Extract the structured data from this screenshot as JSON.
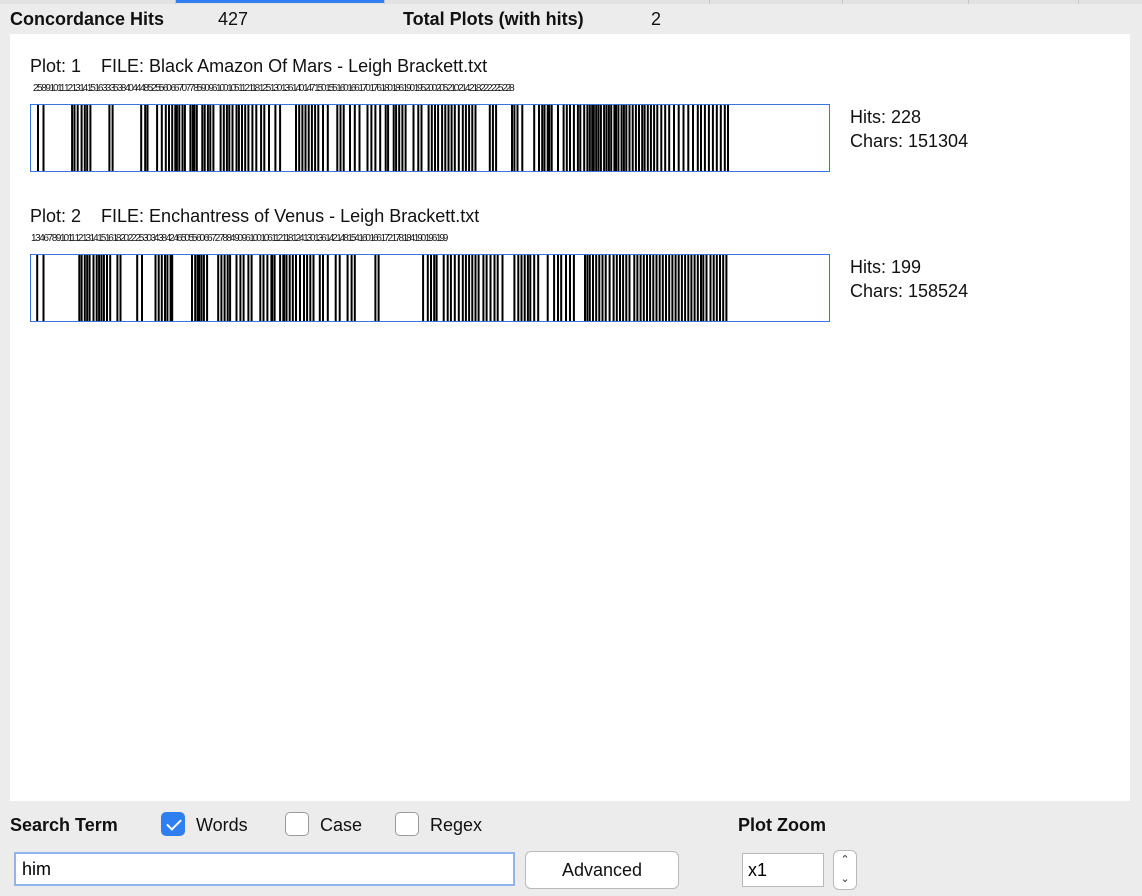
{
  "stats": {
    "concordance_hits_label": "Concordance Hits",
    "concordance_hits_value": "427",
    "total_plots_label": "Total Plots (with hits)",
    "total_plots_value": "2"
  },
  "plots": [
    {
      "title": "Plot: 1    FILE: Black Amazon Of Mars - Leigh Brackett.txt",
      "hits_text": "Hits: 228",
      "chars_text": "Chars: 151304",
      "hits": 228,
      "chars": 151304,
      "hit_positions": [
        0.005,
        0.012,
        0.048,
        0.051,
        0.055,
        0.06,
        0.064,
        0.067,
        0.071,
        0.095,
        0.099,
        0.135,
        0.14,
        0.143,
        0.155,
        0.161,
        0.166,
        0.17,
        0.174,
        0.178,
        0.18,
        0.183,
        0.187,
        0.19,
        0.197,
        0.2,
        0.202,
        0.205,
        0.212,
        0.215,
        0.219,
        0.222,
        0.226,
        0.235,
        0.239,
        0.243,
        0.246,
        0.25,
        0.255,
        0.258,
        0.262,
        0.266,
        0.27,
        0.275,
        0.28,
        0.286,
        0.29,
        0.296,
        0.304,
        0.31,
        0.33,
        0.334,
        0.338,
        0.342,
        0.346,
        0.35,
        0.354,
        0.358,
        0.364,
        0.37,
        0.382,
        0.386,
        0.39,
        0.398,
        0.404,
        0.41,
        0.42,
        0.425,
        0.43,
        0.436,
        0.443,
        0.446,
        0.453,
        0.456,
        0.46,
        0.464,
        0.468,
        0.478,
        0.484,
        0.488,
        0.497,
        0.501,
        0.505,
        0.509,
        0.514,
        0.518,
        0.522,
        0.526,
        0.53,
        0.535,
        0.54,
        0.544,
        0.548,
        0.552,
        0.556,
        0.574,
        0.578,
        0.582,
        0.602,
        0.605,
        0.609,
        0.615,
        0.63,
        0.636,
        0.64,
        0.643,
        0.647,
        0.649,
        0.652,
        0.66,
        0.667,
        0.671,
        0.675,
        0.68,
        0.685,
        0.688,
        0.693,
        0.697,
        0.7,
        0.703,
        0.705,
        0.708,
        0.711,
        0.714,
        0.718,
        0.721,
        0.724,
        0.727,
        0.731,
        0.733,
        0.736,
        0.74,
        0.743,
        0.746,
        0.75,
        0.754,
        0.758,
        0.762,
        0.766,
        0.769,
        0.773,
        0.777,
        0.781,
        0.785,
        0.79,
        0.795,
        0.8,
        0.806,
        0.812,
        0.818,
        0.824,
        0.83,
        0.836,
        0.84,
        0.845,
        0.85,
        0.855,
        0.86,
        0.865,
        0.87,
        0.874
      ],
      "tick_labels": "2 5   8 9 10 11 12 13 14 15 16   33 35 38 40 44 48 52 55 60 66 70 77 85 90 96 100 105 112 118 125 130 136 140 147 150 155 160 166 170 176 180 186 190 195 200 205 210 214 218 222 225 228"
    },
    {
      "title": "Plot: 2    FILE: Enchantress of Venus - Leigh Brackett.txt",
      "hits_text": "Hits: 199",
      "chars_text": "Chars: 158524",
      "hits": 199,
      "chars": 158524,
      "hit_positions": [
        0.004,
        0.012,
        0.057,
        0.06,
        0.064,
        0.067,
        0.07,
        0.075,
        0.079,
        0.082,
        0.085,
        0.088,
        0.092,
        0.096,
        0.105,
        0.109,
        0.13,
        0.136,
        0.153,
        0.157,
        0.161,
        0.165,
        0.168,
        0.172,
        0.174,
        0.199,
        0.203,
        0.206,
        0.208,
        0.211,
        0.214,
        0.218,
        0.232,
        0.236,
        0.24,
        0.244,
        0.247,
        0.255,
        0.26,
        0.264,
        0.27,
        0.274,
        0.285,
        0.289,
        0.294,
        0.299,
        0.3,
        0.303,
        0.31,
        0.314,
        0.315,
        0.318,
        0.322,
        0.326,
        0.33,
        0.335,
        0.34,
        0.344,
        0.348,
        0.352,
        0.36,
        0.364,
        0.37,
        0.38,
        0.385,
        0.395,
        0.4,
        0.404,
        0.43,
        0.434,
        0.49,
        0.496,
        0.5,
        0.504,
        0.507,
        0.516,
        0.521,
        0.525,
        0.53,
        0.535,
        0.54,
        0.544,
        0.548,
        0.552,
        0.556,
        0.56,
        0.566,
        0.57,
        0.575,
        0.58,
        0.584,
        0.59,
        0.605,
        0.61,
        0.614,
        0.618,
        0.622,
        0.625,
        0.63,
        0.635,
        0.647,
        0.655,
        0.66,
        0.664,
        0.67,
        0.675,
        0.68,
        0.694,
        0.697,
        0.7,
        0.704,
        0.708,
        0.712,
        0.716,
        0.72,
        0.725,
        0.73,
        0.734,
        0.738,
        0.742,
        0.746,
        0.75,
        0.756,
        0.76,
        0.764,
        0.768,
        0.772,
        0.776,
        0.78,
        0.784,
        0.788,
        0.792,
        0.796,
        0.8,
        0.804,
        0.808,
        0.812,
        0.816,
        0.82,
        0.824,
        0.828,
        0.832,
        0.836,
        0.84,
        0.843,
        0.847,
        0.852,
        0.856,
        0.86,
        0.864,
        0.868,
        0.872
      ],
      "tick_labels": "1 3     4 6 7 8 9 10 11 12 13 14 15 16 18 20 22 25 30 34 38 42 46 50 55 60 66 72 78 84 90 96 100 106 112 118 124 130 136 142 148 154 160 166 172 178 184 190 196 199"
    }
  ],
  "controls": {
    "search_term_label": "Search Term",
    "words_label": "Words",
    "words_checked": true,
    "case_label": "Case",
    "case_checked": false,
    "regex_label": "Regex",
    "regex_checked": false,
    "search_value": "him",
    "advanced_label": "Advanced",
    "plot_zoom_label": "Plot Zoom",
    "zoom_value": "x1"
  },
  "colors": {
    "accent": "#2f7ff0",
    "plot_border": "#3576e0",
    "bar": "#000000"
  }
}
